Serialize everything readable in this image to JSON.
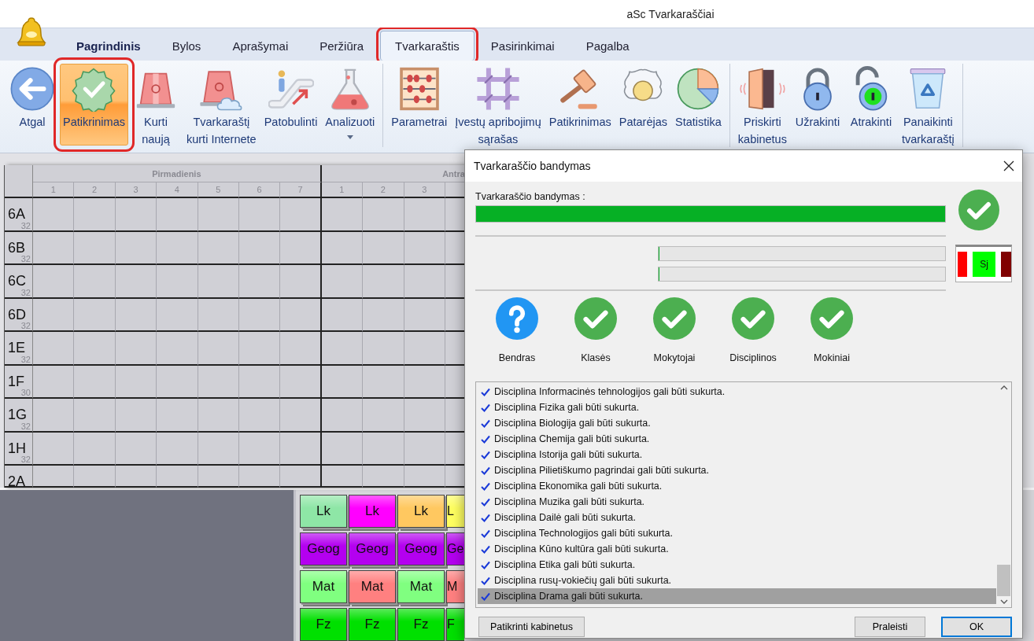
{
  "window": {
    "title": "aSc Tvarkaraščiai"
  },
  "tabs": [
    {
      "label": "Pagrindinis",
      "selected": false,
      "emphasized": true,
      "highlighted": false
    },
    {
      "label": "Bylos",
      "selected": false,
      "emphasized": false,
      "highlighted": false
    },
    {
      "label": "Aprašymai",
      "selected": false,
      "emphasized": false,
      "highlighted": false
    },
    {
      "label": "Peržiūra",
      "selected": false,
      "emphasized": false,
      "highlighted": false
    },
    {
      "label": "Tvarkaraštis",
      "selected": true,
      "emphasized": false,
      "highlighted": true
    },
    {
      "label": "Pasirinkimai",
      "selected": false,
      "emphasized": false,
      "highlighted": false
    },
    {
      "label": "Pagalba",
      "selected": false,
      "emphasized": false,
      "highlighted": false
    }
  ],
  "ribbon": {
    "groups": [
      {
        "buttons": [
          {
            "lines": [
              "Atgal"
            ],
            "selected": false,
            "highlighted": false,
            "dropdown": false
          },
          {
            "lines": [
              "Patikrinimas"
            ],
            "selected": true,
            "highlighted": true,
            "dropdown": false
          },
          {
            "lines": [
              "Kurti",
              "naują"
            ],
            "selected": false,
            "highlighted": false,
            "dropdown": false
          },
          {
            "lines": [
              "Tvarkaraštį",
              "kurti Internete"
            ],
            "selected": false,
            "highlighted": false,
            "dropdown": false
          },
          {
            "lines": [
              "Patobulinti"
            ],
            "selected": false,
            "highlighted": false,
            "dropdown": false
          },
          {
            "lines": [
              "Analizuoti"
            ],
            "selected": false,
            "highlighted": false,
            "dropdown": true
          }
        ]
      },
      {
        "buttons": [
          {
            "lines": [
              "Parametrai"
            ],
            "selected": false,
            "highlighted": false,
            "dropdown": false
          },
          {
            "lines": [
              "Įvestų apribojimų",
              "sąrašas"
            ],
            "selected": false,
            "highlighted": false,
            "dropdown": false
          },
          {
            "lines": [
              "Patikrinimas"
            ],
            "selected": false,
            "highlighted": false,
            "dropdown": false
          },
          {
            "lines": [
              "Patarėjas"
            ],
            "selected": false,
            "highlighted": false,
            "dropdown": false
          },
          {
            "lines": [
              "Statistika"
            ],
            "selected": false,
            "highlighted": false,
            "dropdown": false
          }
        ]
      },
      {
        "buttons": [
          {
            "lines": [
              "Priskirti",
              "kabinetus"
            ],
            "selected": false,
            "highlighted": false,
            "dropdown": false
          },
          {
            "lines": [
              "Užrakinti"
            ],
            "selected": false,
            "highlighted": false,
            "dropdown": false
          },
          {
            "lines": [
              "Atrakinti"
            ],
            "selected": false,
            "highlighted": false,
            "dropdown": false
          },
          {
            "lines": [
              "Panaikinti",
              "tvarkaraštį"
            ],
            "selected": false,
            "highlighted": false,
            "dropdown": false
          }
        ]
      }
    ]
  },
  "timetable": {
    "days": [
      {
        "name": "Pirmadienis",
        "periods": [
          "1",
          "2",
          "3",
          "4",
          "5",
          "6",
          "7"
        ]
      },
      {
        "name": "Antra",
        "periods": [
          "1",
          "2",
          "3"
        ]
      }
    ],
    "rows": [
      {
        "name": "6A",
        "count": "32"
      },
      {
        "name": "6B",
        "count": "32"
      },
      {
        "name": "6C",
        "count": "32"
      },
      {
        "name": "6D",
        "count": "32"
      },
      {
        "name": "1E",
        "count": "32"
      },
      {
        "name": "1F",
        "count": "30"
      },
      {
        "name": "1G",
        "count": "32"
      },
      {
        "name": "1H",
        "count": "32"
      },
      {
        "name": "2A"
      }
    ]
  },
  "card_tray": {
    "cards": [
      {
        "label": "Lk",
        "color": "#8ee6a6"
      },
      {
        "label": "Lk",
        "color": "#ff00ff"
      },
      {
        "label": "Lk",
        "color": "#ffc860"
      },
      {
        "label": "L",
        "color": "#ffff60"
      },
      {
        "label": "Geog",
        "color": "#b400f0"
      },
      {
        "label": "Geog",
        "color": "#b400f0"
      },
      {
        "label": "Geog",
        "color": "#b400f0"
      },
      {
        "label": "Ge",
        "color": "#b400f0"
      },
      {
        "label": "Mat",
        "color": "#80ff80"
      },
      {
        "label": "Mat",
        "color": "#ff8080"
      },
      {
        "label": "Mat",
        "color": "#80ff80"
      },
      {
        "label": "M",
        "color": "#ff8080"
      },
      {
        "label": "Fz",
        "color": "#00e000"
      },
      {
        "label": "Fz",
        "color": "#00e000"
      },
      {
        "label": "Fz",
        "color": "#00e000"
      },
      {
        "label": "F",
        "color": "#00e000"
      }
    ]
  },
  "dialog": {
    "title": "Tvarkaraščio bandymas",
    "progress_label": "Tvarkaraščio bandymas :",
    "progress": {
      "level": 1
    },
    "done": true,
    "sub_progress": [
      {
        "level": 0
      },
      {
        "level": 0
      }
    ],
    "legend": [
      {
        "color": "#ff0000"
      },
      {
        "label": "Sj",
        "color": "#00ff00"
      },
      {
        "color": "#800000"
      }
    ],
    "checks": [
      {
        "label": "Bendras",
        "kind": "unknown"
      },
      {
        "label": "Klasės",
        "kind": "ok"
      },
      {
        "label": "Mokytojai",
        "kind": "ok"
      },
      {
        "label": "Disciplinos",
        "kind": "ok"
      },
      {
        "label": "Mokiniai",
        "kind": "ok"
      }
    ],
    "log": [
      {
        "text": "Disciplina Informacinės tehnologijos gali būti sukurta.",
        "checked": true,
        "selected": false
      },
      {
        "text": "Disciplina Fizika gali būti sukurta.",
        "checked": true,
        "selected": false
      },
      {
        "text": "Disciplina Biologija gali būti sukurta.",
        "checked": true,
        "selected": false
      },
      {
        "text": "Disciplina Chemija gali būti sukurta.",
        "checked": true,
        "selected": false
      },
      {
        "text": "Disciplina Istorija gali būti sukurta.",
        "checked": true,
        "selected": false
      },
      {
        "text": "Disciplina Pilietiškumo pagrindai gali būti sukurta.",
        "checked": true,
        "selected": false
      },
      {
        "text": "Disciplina Ekonomika gali būti sukurta.",
        "checked": true,
        "selected": false
      },
      {
        "text": "Disciplina Muzika gali būti sukurta.",
        "checked": true,
        "selected": false
      },
      {
        "text": "Disciplina Dailė gali būti sukurta.",
        "checked": true,
        "selected": false
      },
      {
        "text": "Disciplina Technologijos gali būti sukurta.",
        "checked": true,
        "selected": false
      },
      {
        "text": "Disciplina Kūno kultūra gali būti sukurta.",
        "checked": true,
        "selected": false
      },
      {
        "text": "Disciplina Etika gali būti sukurta.",
        "checked": true,
        "selected": false
      },
      {
        "text": "Disciplina rusų-vokiečių gali būti sukurta.",
        "checked": true,
        "selected": false
      },
      {
        "text": "Disciplina Drama gali būti sukurta.",
        "checked": true,
        "selected": true
      }
    ],
    "buttons": [
      {
        "label": "Patikrinti kabinetus",
        "default": false
      },
      {
        "label": "Praleisti",
        "default": false
      },
      {
        "label": "OK",
        "default": true
      }
    ]
  }
}
